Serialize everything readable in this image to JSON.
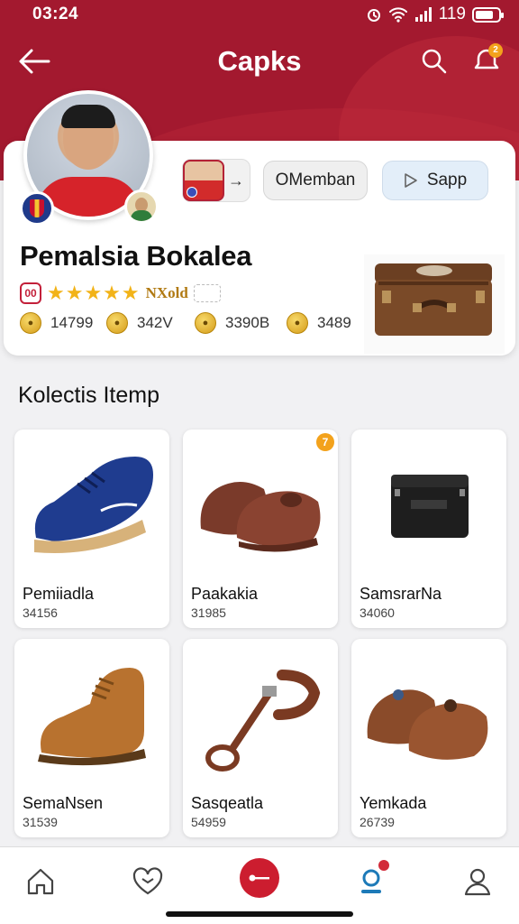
{
  "status": {
    "time": "03:24",
    "battery": "119"
  },
  "header": {
    "title": "Capks",
    "notification_count": "2"
  },
  "profile": {
    "name": "Pemalsia Bokalea",
    "rating_icon": "00",
    "stars": "★★★★★",
    "rank": "NXold",
    "follow_arrow": "→",
    "buttons": {
      "member": "OMemban",
      "sapp": "Sapp"
    },
    "stats": [
      {
        "value": "14799"
      },
      {
        "value": "342V"
      },
      {
        "value": "3390B"
      },
      {
        "value": "3489"
      }
    ]
  },
  "collection": {
    "title": "Kolectis Itemp",
    "items": [
      {
        "name": "Pemiiadla",
        "price": "34156"
      },
      {
        "name": "Paakakia",
        "price": "31985",
        "badge": "7"
      },
      {
        "name": "SamsrarNa",
        "price": "34060"
      },
      {
        "name": "SemaNsen",
        "price": "31539"
      },
      {
        "name": "Sasqeatla",
        "price": "54959"
      },
      {
        "name": "Yemkada",
        "price": "26739"
      }
    ]
  },
  "colors": {
    "brand": "#a3192f",
    "accent": "#cc1d2f",
    "active_tab": "#1d7ab8",
    "star": "#f2b318"
  },
  "icons": {
    "header": [
      "back-arrow-icon",
      "search-icon",
      "notification-icon"
    ],
    "nav": [
      "home-icon",
      "heart-chat-icon",
      "key-icon",
      "trophy-icon",
      "profile-icon"
    ]
  }
}
